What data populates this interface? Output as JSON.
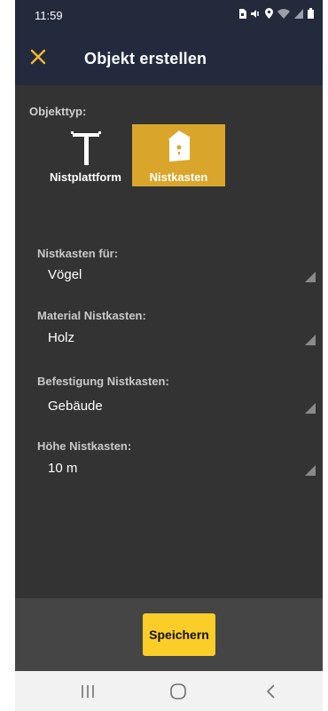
{
  "status_bar": {
    "time": "11:59",
    "icons": [
      "sim-icon",
      "mute-icon",
      "location-icon",
      "wifi-icon",
      "signal-icon",
      "battery-icon"
    ]
  },
  "app_bar": {
    "title": "Objekt erstellen",
    "close_icon": "close-icon",
    "accent_color": "#f5b731",
    "background": "#232a3e"
  },
  "object_type": {
    "label": "Objekttyp:",
    "options": [
      {
        "label": "Nistplattform",
        "icon": "platform-icon",
        "selected": false
      },
      {
        "label": "Nistkasten",
        "icon": "nest-box-icon",
        "selected": true
      }
    ],
    "selected_color": "#d9a62b"
  },
  "fields": [
    {
      "label": "Nistkasten für:",
      "value": "Vögel"
    },
    {
      "label": "Material Nistkasten:",
      "value": "Holz"
    },
    {
      "label": "Befestigung Nistkasten:",
      "value": "Gebäude"
    },
    {
      "label": "Höhe Nistkasten:",
      "value": "10 m"
    }
  ],
  "footer": {
    "save_label": "Speichern",
    "save_color": "#fbcd28"
  },
  "nav_bar": {
    "buttons": [
      "recent-apps-icon",
      "home-icon",
      "back-icon"
    ]
  }
}
